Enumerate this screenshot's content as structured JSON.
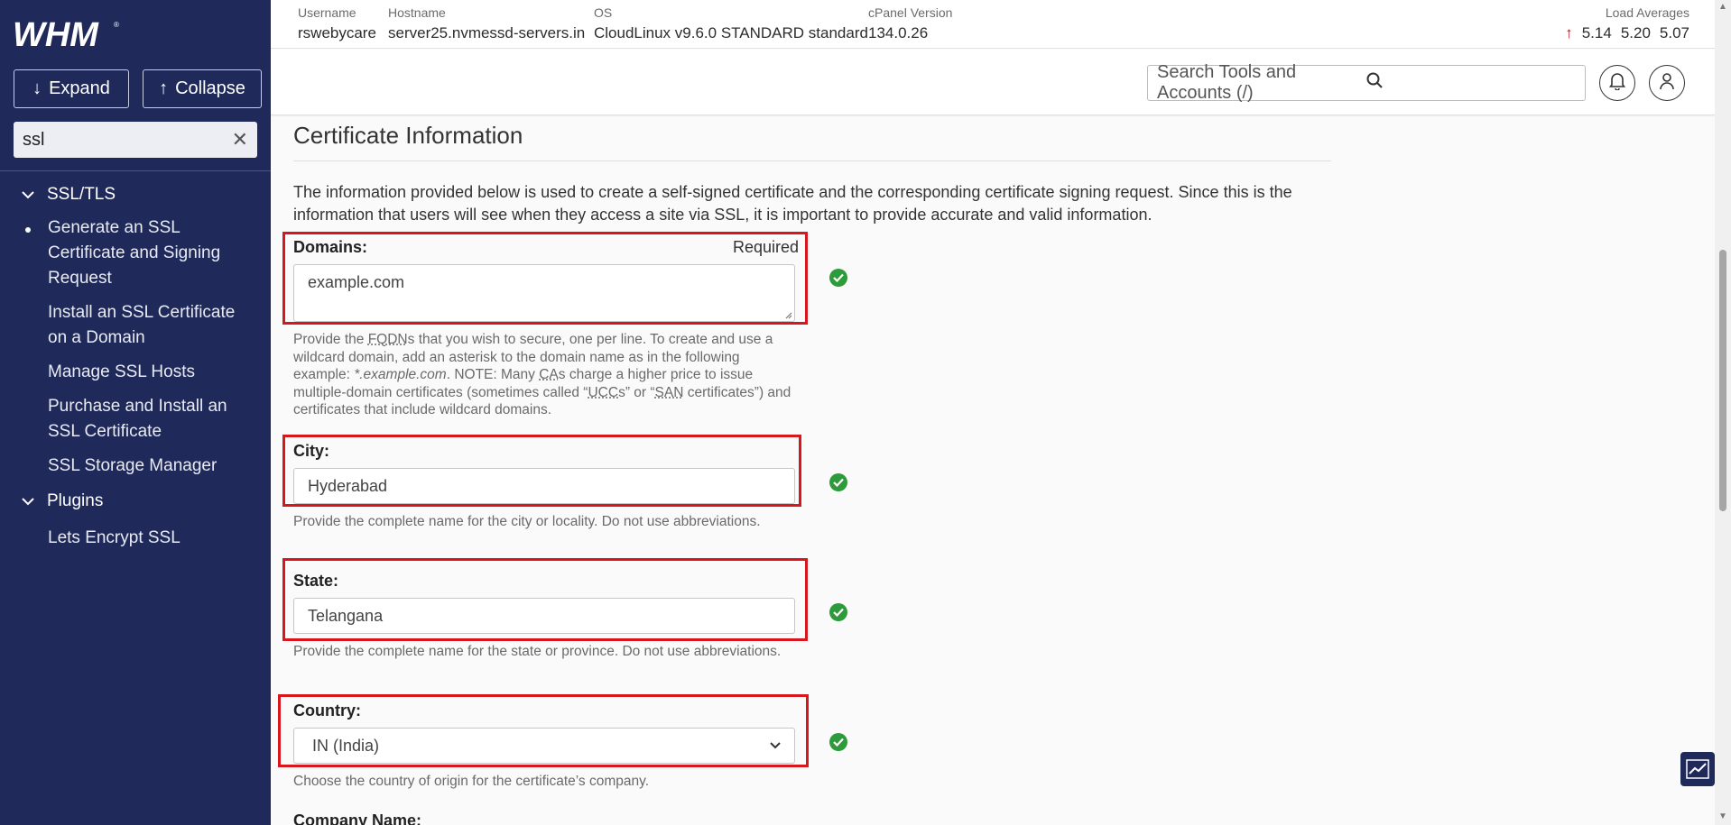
{
  "sidebar": {
    "logo_text": "WHM",
    "expand_label": "Expand",
    "collapse_label": "Collapse",
    "search_value": "ssl",
    "sections": [
      {
        "label": "SSL/TLS"
      },
      {
        "label": "Plugins"
      }
    ],
    "items": [
      {
        "label": "Generate an SSL Certificate and Signing Request"
      },
      {
        "label": "Install an SSL Certificate on a Domain"
      },
      {
        "label": "Manage SSL Hosts"
      },
      {
        "label": "Purchase and Install an SSL Certificate"
      },
      {
        "label": "SSL Storage Manager"
      },
      {
        "label": "Lets Encrypt SSL"
      }
    ]
  },
  "topbar": {
    "username_label": "Username",
    "username": "rswebycare",
    "hostname_label": "Hostname",
    "hostname": "server25.nvmessd-servers.in",
    "os_label": "OS",
    "os": "CloudLinux v9.6.0 STANDARD standard",
    "cpanel_label": "cPanel Version",
    "cpanel": "134.0.26",
    "load_label": "Load Averages",
    "load_1": "5.14",
    "load_2": "5.20",
    "load_3": "5.07"
  },
  "search": {
    "placeholder": "Search Tools and Accounts (/)"
  },
  "main": {
    "title": "Certificate Information",
    "intro": "The information provided below is used to create a self-signed certificate and the corresponding certificate signing request. Since this is the information that users will see when they access a site via SSL, it is important to provide accurate and valid information.",
    "domains": {
      "label": "Domains:",
      "required": "Required",
      "value": "example.com",
      "help_1": "Provide the ",
      "help_fqdn": "FQDN",
      "help_2": "s that you wish to secure, one per line. To create and use a wildcard domain, add an asterisk to the domain name as in the following example: ",
      "help_example": "*.example.com",
      "help_3": ". NOTE: Many ",
      "help_ca": "CA",
      "help_4": "s charge a higher price to issue multiple-domain certificates (sometimes called “",
      "help_ucc": "UCC",
      "help_5": "s” or “",
      "help_san": "SAN",
      "help_6": " certificates”) and certificates that include wildcard domains."
    },
    "city": {
      "label": "City:",
      "value": "Hyderabad",
      "help": "Provide the complete name for the city or locality. Do not use abbreviations."
    },
    "state": {
      "label": "State:",
      "value": "Telangana",
      "help": "Provide the complete name for the state or province. Do not use abbreviations."
    },
    "country": {
      "label": "Country:",
      "value": "IN (India)",
      "help": "Choose the country of origin for the certificate’s company."
    },
    "company_label": "Company Name:"
  },
  "colors": {
    "sidebar_bg": "#1f2a5a",
    "highlight": "#d8161e",
    "valid": "#2e9b3a"
  }
}
